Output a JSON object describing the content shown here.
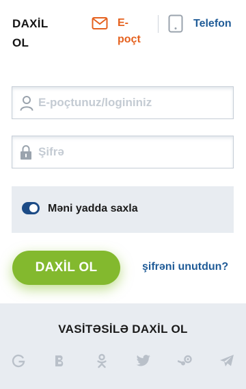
{
  "header": {
    "title_line1": "DAXİL",
    "title_line2": "OL",
    "tab_email": {
      "label_line1": "E-",
      "label_line2": "poçt",
      "icon": "envelope-icon"
    },
    "tab_phone": {
      "label": "Telefon",
      "icon": "phone-icon"
    }
  },
  "form": {
    "login": {
      "placeholder": "E-poçtunuz/logininiz",
      "value": "",
      "icon": "user-icon"
    },
    "password": {
      "placeholder": "Şifrə",
      "value": "",
      "icon": "lock-icon"
    },
    "remember": {
      "label": "Məni yadda saxla",
      "checked": true
    },
    "submit_label": "DAXİL OL",
    "forgot_label": "şifrəni unutdun?"
  },
  "social": {
    "title": "VASİTƏSİLƏ DAXİL OL",
    "icons": [
      "google-icon",
      "vk-icon",
      "odnoklassniki-icon",
      "twitter-icon",
      "steam-icon",
      "telegram-icon"
    ]
  },
  "colors": {
    "accent_orange": "#e5611e",
    "link_blue": "#1f5b97",
    "button_green": "#83b92e",
    "toggle_blue": "#1c4b86",
    "panel_gray": "#e8ecf1"
  }
}
